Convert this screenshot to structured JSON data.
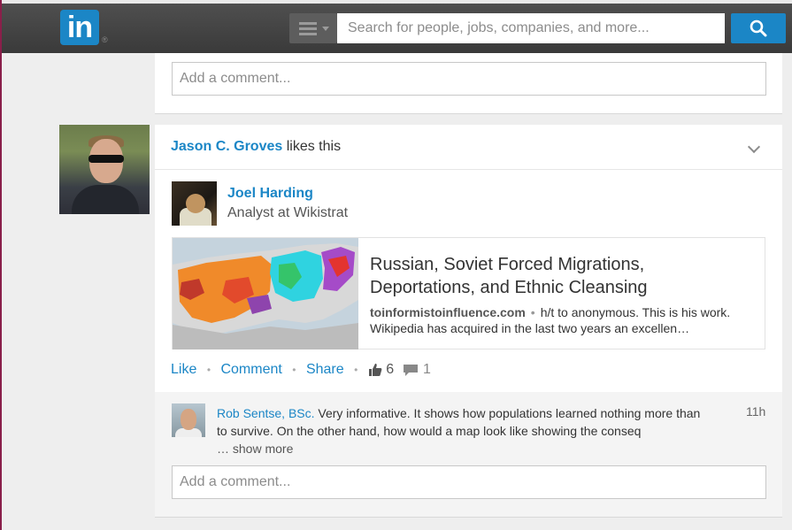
{
  "brand": {
    "logo_text": "in",
    "registered": "®",
    "accent": "#1b86c6"
  },
  "search": {
    "placeholder": "Search for people, jobs, companies, and more..."
  },
  "previous_card": {
    "comment_placeholder": "Add a comment..."
  },
  "feed_item": {
    "header": {
      "actor_name": "Jason C. Groves",
      "action": " likes this"
    },
    "author": {
      "name": "Joel Harding",
      "headline": "Analyst at Wikistrat"
    },
    "article": {
      "title": "Russian, Soviet Forced Migrations, Deportations, and Ethnic Cleansing",
      "source": "toinformistoinfluence.com",
      "separator": "•",
      "snippet": "h/t to anonymous. This is his work. Wikipedia has acquired in the last two years an excellen…"
    },
    "actions": {
      "like": "Like",
      "comment": "Comment",
      "share": "Share",
      "separator": "•",
      "like_count": "6",
      "comment_count": "1"
    },
    "comment": {
      "author": "Rob Sentse, BSc.",
      "text": " Very informative. It shows how populations learned nothing more than to survive. On the other hand, how would a map look like showing the conseq",
      "show_more": "… show more",
      "time": "11h"
    },
    "comment_placeholder": "Add a comment..."
  }
}
